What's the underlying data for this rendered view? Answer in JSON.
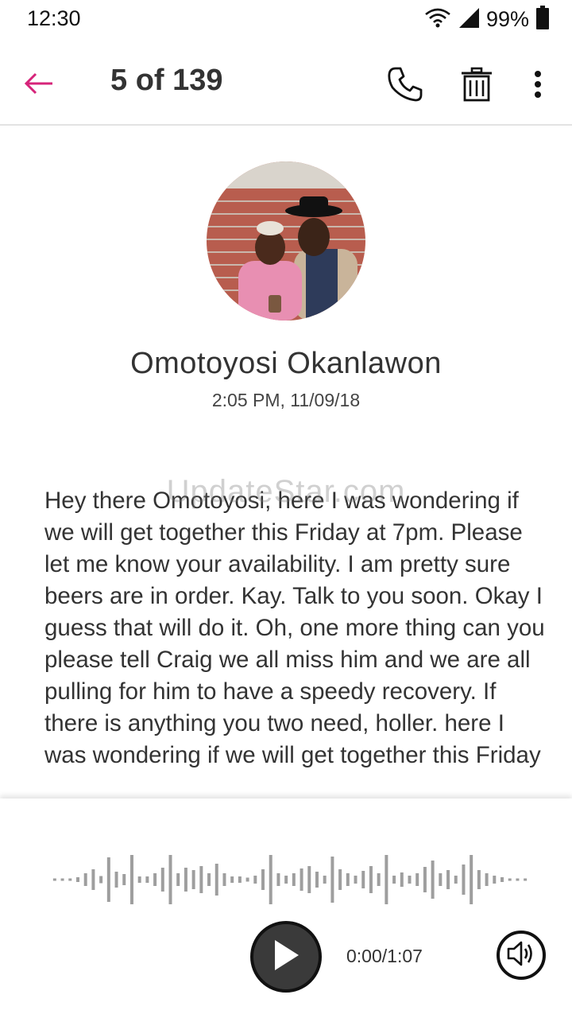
{
  "status_bar": {
    "time": "12:30",
    "battery_percent": "99%",
    "icons": [
      "wifi-icon",
      "cell-signal-icon",
      "battery-icon"
    ]
  },
  "app_bar": {
    "counter": "5 of 139",
    "accent_color": "#d6247a",
    "icons": [
      "back-arrow-icon",
      "phone-icon",
      "trash-icon",
      "more-vert-icon"
    ]
  },
  "contact": {
    "name": "Omotoyosi Okanlawon",
    "timestamp": "2:05 PM, 11/09/18"
  },
  "watermark": "UpdateStar.com",
  "message": {
    "transcript": "Hey there Omotoyosi, here I was wondering if we will get together this Friday at 7pm. Please let me know your availability.  I am pretty sure beers are in order.  Kay.  Talk to you soon.  Okay I guess that will do it.  Oh, one more thing can you please tell Craig we all miss him and we are all pulling for him to have a speedy recovery.  If there is anything you two need, holler. here I was wondering if we will get together this Friday"
  },
  "player": {
    "time_readout": "0:00/1:07",
    "progress": 0,
    "icons": [
      "play-icon",
      "volume-icon"
    ]
  }
}
